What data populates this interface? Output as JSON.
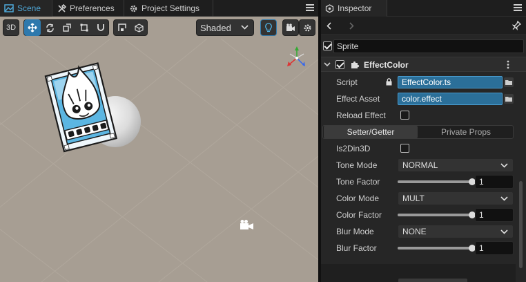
{
  "scene_panel": {
    "tabs": [
      {
        "label": "Scene",
        "icon": "scene-icon",
        "active": true
      },
      {
        "label": "Preferences",
        "icon": "tools-icon",
        "active": false
      },
      {
        "label": "Project Settings",
        "icon": "gear-icon",
        "active": false
      }
    ],
    "toolbar": {
      "mode_label": "3D",
      "shading_select": "Shaded"
    }
  },
  "inspector": {
    "tab_label": "Inspector",
    "node": {
      "enabled": true,
      "name": "Sprite"
    },
    "component": {
      "title": "EffectColor",
      "enabled": true,
      "script_label": "Script",
      "script_value": "EffectColor.ts",
      "effect_asset_label": "Effect Asset",
      "effect_asset_value": "color.effect",
      "reload_effect_label": "Reload Effect",
      "reload_effect_checked": false,
      "segments": [
        {
          "label": "Setter/Getter",
          "active": true
        },
        {
          "label": "Private Props",
          "active": false
        }
      ],
      "is2din3d_label": "Is2Din3D",
      "is2din3d_checked": false,
      "tone_mode_label": "Tone Mode",
      "tone_mode_value": "NORMAL",
      "tone_factor_label": "Tone Factor",
      "tone_factor_value": "1",
      "color_mode_label": "Color Mode",
      "color_mode_value": "MULT",
      "color_factor_label": "Color Factor",
      "color_factor_value": "1",
      "blur_mode_label": "Blur Mode",
      "blur_mode_value": "NONE",
      "blur_factor_label": "Blur Factor",
      "blur_factor_value": "1",
      "slider_max": 1
    }
  },
  "colors": {
    "accent": "#2e79ad",
    "scene_background": "#a79e93",
    "asset_field": "#2b6f99",
    "panel_background": "#262626"
  }
}
